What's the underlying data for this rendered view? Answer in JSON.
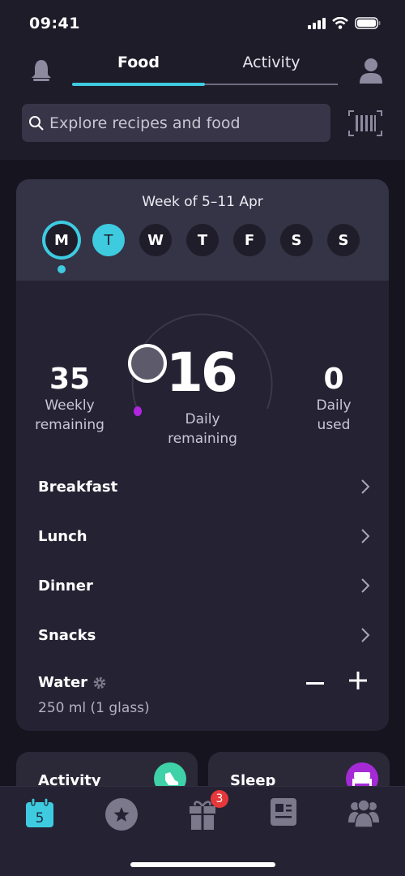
{
  "status_bar": {
    "time": "09:41"
  },
  "header": {
    "tabs": [
      {
        "label": "Food",
        "active": true
      },
      {
        "label": "Activity",
        "active": false
      }
    ],
    "search": {
      "placeholder": "Explore recipes and food"
    },
    "accent_color": "#3ecbe0"
  },
  "week": {
    "title": "Week of 5–11 Apr",
    "days": [
      "M",
      "T",
      "W",
      "T",
      "F",
      "S",
      "S"
    ],
    "selected_index": 0,
    "today_index": 1
  },
  "summary": {
    "weekly": {
      "value": "35",
      "label1": "Weekly",
      "label2": "remaining"
    },
    "daily": {
      "value": "16",
      "label1": "Daily",
      "label2": "remaining"
    },
    "used": {
      "value": "0",
      "label1": "Daily",
      "label2": "used"
    },
    "gauge_progress": 0.0
  },
  "meals": [
    {
      "label": "Breakfast"
    },
    {
      "label": "Lunch"
    },
    {
      "label": "Dinner"
    },
    {
      "label": "Snacks"
    }
  ],
  "water": {
    "label": "Water",
    "amount": "250 ml (1 glass)"
  },
  "mini_cards": [
    {
      "title": "Activity",
      "icon_color": "#3fd1a8"
    },
    {
      "title": "Sleep",
      "icon_color": "#a52ad6"
    }
  ],
  "bottom_nav": {
    "calendar_day": "5",
    "rewards_badge": "3"
  }
}
